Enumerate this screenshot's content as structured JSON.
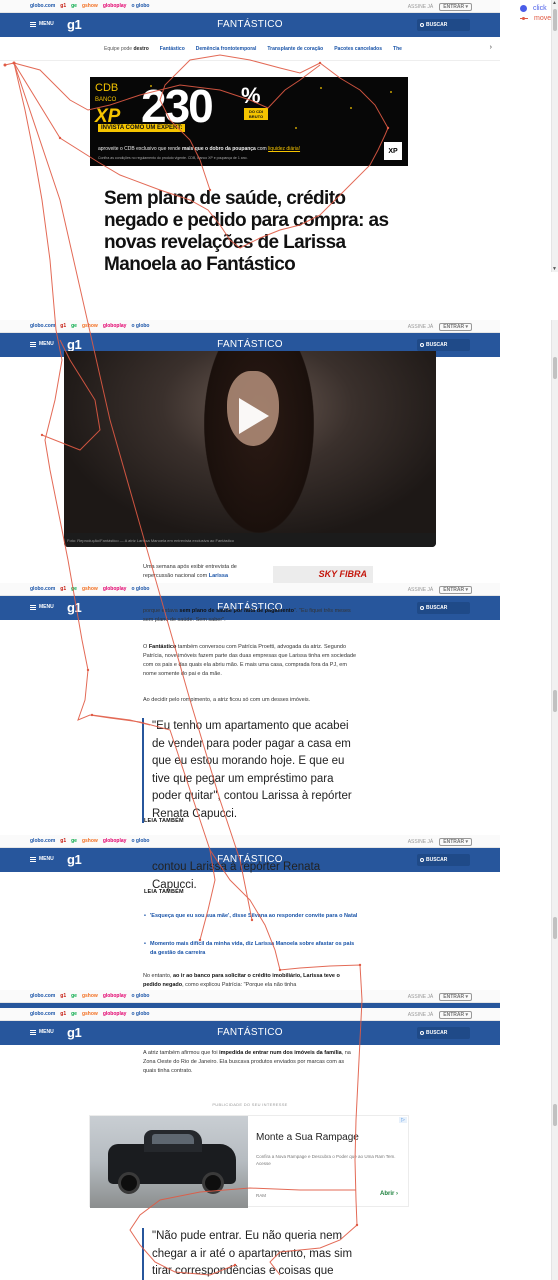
{
  "globo_bar": {
    "links": [
      "globo.com",
      "g1",
      "ge",
      "gshow",
      "globoplay",
      "o globo"
    ],
    "account_label": "ASSINE JÁ",
    "account_button": "ENTRAR ▾"
  },
  "header": {
    "menu_label": "MENU",
    "logo": "g1",
    "section_title": "FANTÁSTICO",
    "search_label": "BUSCAR"
  },
  "subnav": {
    "prefix": "Equipe pode",
    "prefix_bold": "destro",
    "items": [
      "Fantástico",
      "Demência frontotemporal",
      "Transplante de coração",
      "Pacotes cancelados",
      "The"
    ]
  },
  "ad_top": {
    "brand_line1": "CDB",
    "brand_line2": "BANCO",
    "brand_xp": "XP",
    "rate": "230",
    "percent": "%",
    "rate_note": "DO CDI BRUTO",
    "cta": "INVISTA COMO UM EXPERT:",
    "desc_start": "aproveite o CDB exclusivo que rende",
    "desc_bold": "mais que o dobro da poupança",
    "desc_mid": "com",
    "desc_link": "liquidez diária!",
    "fine": "Confira as condições no regulamento do produto vigente. CDB, Banco XP e poupança de 1 ano.",
    "logo": "XP"
  },
  "article": {
    "headline": "Sem plano de saúde, crédito negado e pedido para compra: as novas revelações de Larissa Manoela ao Fantástico",
    "video_caption": "Foto: Reprodução/Fantástico — A atriz Larissa Manoela em entrevista exclusiva ao Fantástico",
    "p1_start": "Uma semana após exibir entrevista de repercussão nacional com",
    "p1_link": "Larissa",
    "p2_start": "porque estava",
    "p2_bold": "sem plano de saúde por falta de pagamento",
    "p2_end": "\". \"Eu fiquei três meses sem plano de saúde. Sem saber\".",
    "p3_start": "O",
    "p3_bold": "Fantástico",
    "p3_text": "também conversou com Patrícia Proetti, advogada da atriz. Segundo Patrícia, nove imóveis fazem parte das duas empresas que Larissa tinha em sociedade com os pais e das quais ela abriu mão. E mais uma casa, comprada fora da PJ, em nome somente do pai e da mãe.",
    "p4": "Ao decidir pelo rompimento, a atriz ficou só com um desses imóveis.",
    "quote1": "\"Eu tenho um apartamento que acabei de vender para poder pagar a casa em que eu estou morando hoje. E que eu tive que pegar um empréstimo para poder quitar\", contou Larissa à repórter Renata Capucci.",
    "quote1_tail": "contou Larissa à repórter Renata Capucci.",
    "leia_tambem": "LEIA TAMBÉM",
    "related": [
      "'Esqueça que eu sou sua mãe', disse Silvana ao responder convite para o Natal",
      "Momento mais difícil da minha vida, diz Larissa Manoela sobre afastar os pais da gestão da carreira"
    ],
    "p5_start": "No entanto,",
    "p5_bold": "ao ir ao banco para solicitar o crédito imobiliário, Larissa teve o pedido negado",
    "p5_end": ", como explicou Patrícia: \"Porque ela não tinha",
    "p6_start": "A atriz também afirmou que foi",
    "p6_bold": "impedida de entrar num dos imóveis da família",
    "p6_end": ", na Zona Oeste do Rio de Janeiro. Ela buscava produtos enviados por marcas com as quais tinha contrato.",
    "quote2": "\"Não pude entrar. Eu não queria nem chegar a ir até o apartamento, mas sim tirar correspondências e coisas que vinham em"
  },
  "ad_sky": {
    "text": "SKY FIBRA"
  },
  "ad_bottom": {
    "label": "PUBLICIDADE DO SEU INTERESSE",
    "headline": "Monte a Sua Rampage",
    "sub": "Confira a Nova Rampage e Descubra o Poder que ao Uma Ram Tem. Acesse",
    "brand": "RAM",
    "open": "Abrir ›",
    "adchoice": "▷"
  },
  "legend": {
    "click": "click",
    "move": "move"
  },
  "colors": {
    "header_blue": "#27569c",
    "link_blue": "#1a54a8",
    "trace": "#e05a44",
    "click_dot": "#4a5de8"
  }
}
